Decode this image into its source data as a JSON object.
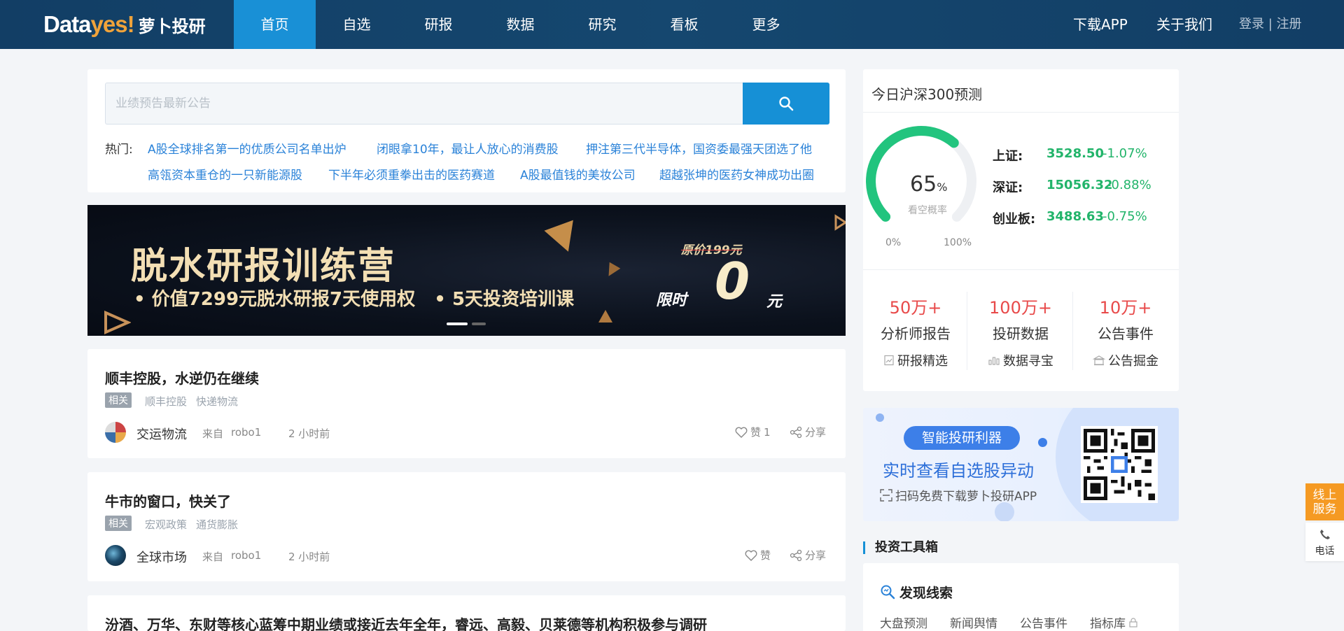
{
  "logo": {
    "part1": "Data",
    "part2": "yes!",
    "cn": "萝卜投研"
  },
  "nav": {
    "items": [
      "首页",
      "自选",
      "研报",
      "数据",
      "研究",
      "看板",
      "更多"
    ],
    "download": "下载APP",
    "about": "关于我们",
    "login": "登录",
    "separator": "|",
    "register": "注册"
  },
  "search": {
    "placeholder": "业绩预告最新公告",
    "hot_label": "热门:",
    "hot_links": [
      "A股全球排名第一的优质公司名单出炉",
      "闭眼拿10年，最让人放心的消费股",
      "押注第三代半导体，国资委最强天团选了他",
      "高瓴资本重仓的一只新能源股",
      "下半年必须重拳出击的医药赛道",
      "A股最值钱的美妆公司",
      "超越张坤的医药女神成功出圈"
    ]
  },
  "banner": {
    "title": "脱水研报训练营",
    "sub1": "• 价值7299元脱水研报7天使用权",
    "sub2": "• 5天投资培训课",
    "orig_price": "原价199元",
    "limit": "限时",
    "zero": "0",
    "yuan": "元"
  },
  "news": [
    {
      "title": "顺丰控股，水逆仍在继续",
      "tag": "相关",
      "tags": [
        "顺丰控股",
        "快递物流"
      ],
      "author": "交运物流",
      "from": "来自",
      "source": "robo1",
      "time": "2 小时前",
      "like": "赞",
      "like_count": "1",
      "share": "分享"
    },
    {
      "title": "牛市的窗口，快关了",
      "tag": "相关",
      "tags": [
        "宏观政策",
        "通货膨胀"
      ],
      "author": "全球市场",
      "from": "来自",
      "source": "robo1",
      "time": "2 小时前",
      "like": "赞",
      "like_count": "",
      "share": "分享"
    },
    {
      "title": "汾酒、万华、东财等核心蓝筹中期业绩或接近去年全年，睿远、高毅、贝莱德等机构积极参与调研"
    }
  ],
  "prediction": {
    "title": "今日沪深300预测",
    "percent": "65",
    "percent_unit": "%",
    "percent_value": 65,
    "prob_label": "看空概率",
    "min": "0%",
    "max": "100%",
    "indices": [
      {
        "name": "上证:",
        "value": "3528.50",
        "change": "-1.07%"
      },
      {
        "name": "深证:",
        "value": "15056.32",
        "change": "-0.88%"
      },
      {
        "name": "创业板:",
        "value": "3488.63",
        "change": "-0.75%"
      }
    ],
    "stats": [
      {
        "big": "50万+",
        "label": "分析师报告",
        "link": "研报精选"
      },
      {
        "big": "100万+",
        "label": "投研数据",
        "link": "数据寻宝"
      },
      {
        "big": "10万+",
        "label": "公告事件",
        "link": "公告掘金"
      }
    ]
  },
  "promo": {
    "pill": "智能投研利器",
    "main": "实时查看自选股异动",
    "sub": "扫码免费下载萝卜投研APP"
  },
  "tools": {
    "heading": "投资工具箱",
    "title": "发现线索",
    "links": [
      "大盘预测",
      "新闻舆情",
      "公告事件",
      "指标库"
    ]
  },
  "float": {
    "service": [
      "线上",
      "服务"
    ],
    "phone": "电话"
  },
  "colors": {
    "nav_bg": "#15476f",
    "active": "#1990d6",
    "up_red": "#e84a4a",
    "down_green": "#22b46a",
    "link": "#2a82d8",
    "accent_orange": "#f59a23"
  }
}
